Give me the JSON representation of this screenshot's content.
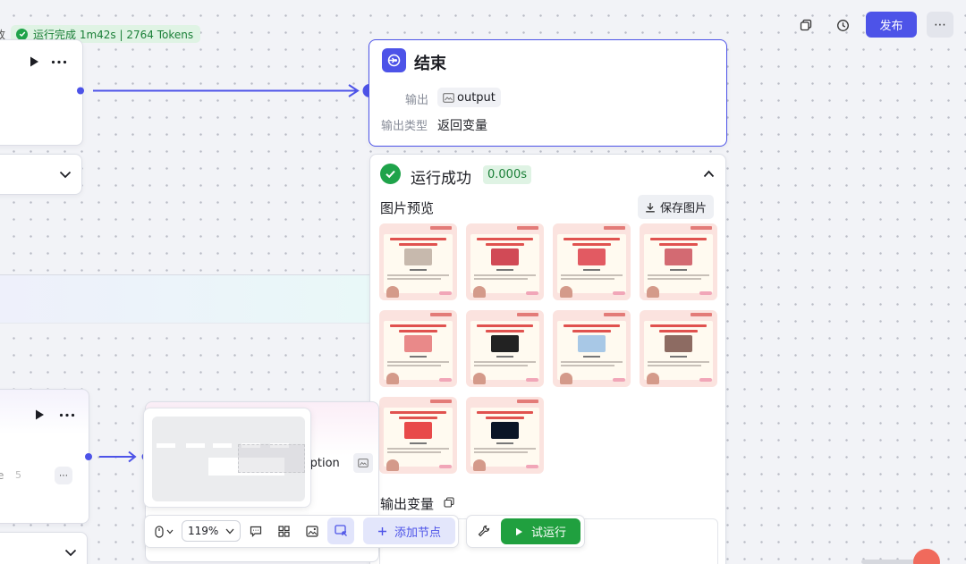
{
  "status_bar": {
    "edge_char": "改",
    "text": "运行完成 1m42s | 2764 Tokens"
  },
  "topbar": {
    "publish_label": "发布",
    "more_glyph": "⋯"
  },
  "end_node": {
    "title": "结束",
    "output_label": "输出",
    "output_var": "output",
    "output_type_label": "输出类型",
    "output_type_value": "返回变量"
  },
  "result_panel": {
    "status": "运行成功",
    "duration": "0.000s",
    "image_preview_label": "图片预览",
    "save_image_label": "保存图片",
    "output_vars_label": "输出变量",
    "thumbnails": [
      {
        "name": "thumb-1",
        "img_color": "#c7b9ad"
      },
      {
        "name": "thumb-2",
        "img_color": "#d14a56"
      },
      {
        "name": "thumb-3",
        "img_color": "#e25a62"
      },
      {
        "name": "thumb-4",
        "img_color": "#d36a72"
      },
      {
        "name": "thumb-5",
        "img_color": "#e98989"
      },
      {
        "name": "thumb-6",
        "img_color": "#222222"
      },
      {
        "name": "thumb-7",
        "img_color": "#a8c8e6"
      },
      {
        "name": "thumb-8",
        "img_color": "#8d6b62"
      },
      {
        "name": "thumb-9",
        "img_color": "#e84a4a"
      },
      {
        "name": "thumb-10",
        "img_color": "#0a1526"
      }
    ]
  },
  "left_node": {
    "edge_text": "e",
    "badge": "5",
    "desc_text": "iption"
  },
  "toolbar": {
    "zoom": "119%",
    "add_node_label": "添加节点",
    "test_run_label": "试运行"
  },
  "colors": {
    "accent": "#4d53e8",
    "success": "#1fa34a",
    "run_button": "#20a03f"
  }
}
